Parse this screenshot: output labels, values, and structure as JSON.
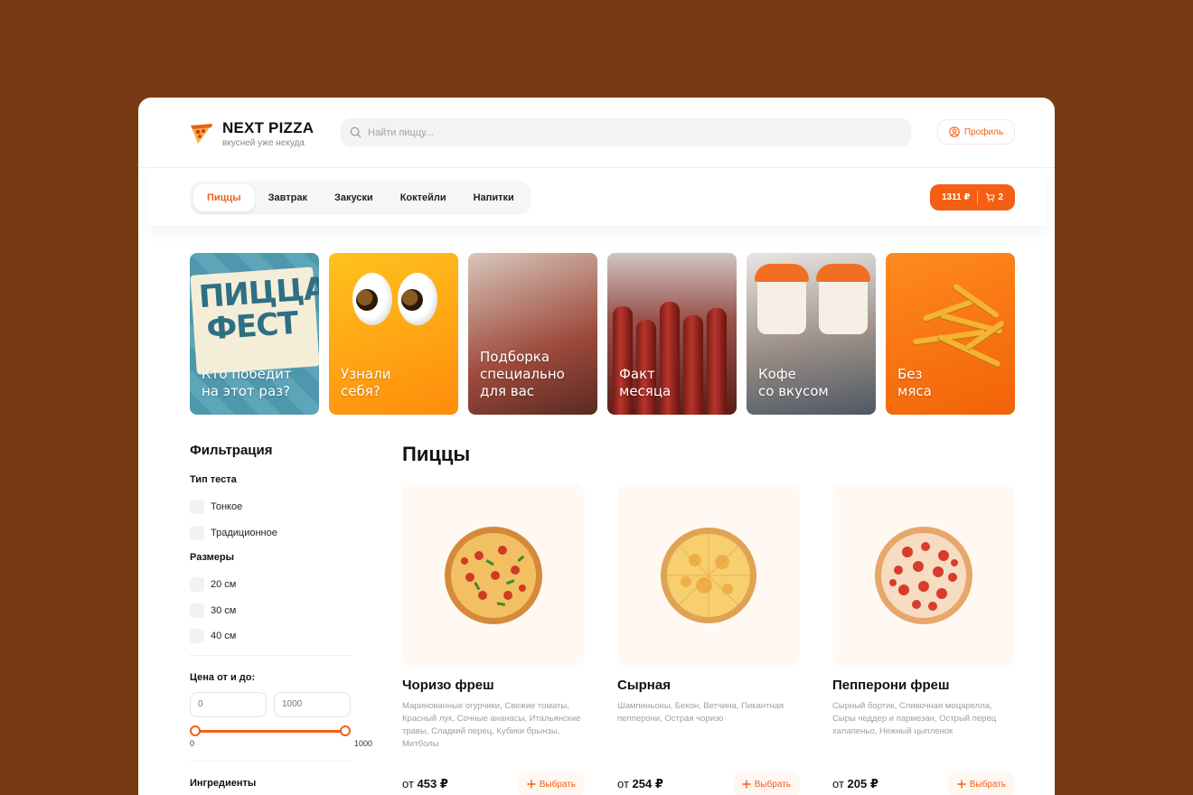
{
  "header": {
    "logo_title": "NEXT PIZZA",
    "logo_subtitle": "вкусней уже некуда",
    "search_placeholder": "Найти пиццу...",
    "profile_label": "Профиль"
  },
  "nav": {
    "tabs": [
      {
        "label": "Пиццы",
        "active": true
      },
      {
        "label": "Завтрак",
        "active": false
      },
      {
        "label": "Закуски",
        "active": false
      },
      {
        "label": "Коктейли",
        "active": false
      },
      {
        "label": "Напитки",
        "active": false
      }
    ],
    "cart_total": "1311 ₽",
    "cart_count": "2"
  },
  "stories": [
    {
      "caption": "Кто победит\nна этот раз?",
      "art_text": [
        "ПИЦЦА",
        "ФЕСТ"
      ]
    },
    {
      "caption": "Узнали\nсебя?"
    },
    {
      "caption": "Подборка\nспециально\nдля вас"
    },
    {
      "caption": "Факт\nмесяца"
    },
    {
      "caption": "Кофе\nсо вкусом"
    },
    {
      "caption": "Без\nмяса"
    }
  ],
  "filters": {
    "title": "Фильтрация",
    "dough_title": "Тип теста",
    "dough": [
      "Тонкое",
      "Традиционное"
    ],
    "sizes_title": "Размеры",
    "sizes": [
      "20 см",
      "30 см",
      "40 см"
    ],
    "price_title": "Цена от и до:",
    "price_from": "0",
    "price_to": "1000",
    "range_min_label": "0",
    "range_max_label": "1000",
    "ingredients_title": "Ингредиенты"
  },
  "catalog": {
    "title": "Пиццы",
    "add_label": "Выбрать",
    "price_prefix": "от",
    "products": [
      {
        "name": "Чоризо фреш",
        "description": "Маринованные огурчики, Свежие томаты, Красный лук, Сочные ананасы, Итальянские травы, Сладкий перец, Кубики брынзы, Митболы",
        "price": "453 ₽",
        "style": "chorizo"
      },
      {
        "name": "Сырная",
        "description": "Шампиньоны, Бекон, Ветчина, Пикантная пепперони, Острая чоризо",
        "price": "254 ₽",
        "style": "cheese"
      },
      {
        "name": "Пепперони фреш",
        "description": "Сырный бортик, Сливочная моцарелла, Сыры чеддер и пармезан, Острый перец халапеньо, Нежный цыпленок",
        "price": "205 ₽",
        "style": "pepperoni"
      }
    ]
  },
  "colors": {
    "accent": "#f45f13",
    "page_background": "#773a12",
    "card_background": "#fff8f3"
  }
}
